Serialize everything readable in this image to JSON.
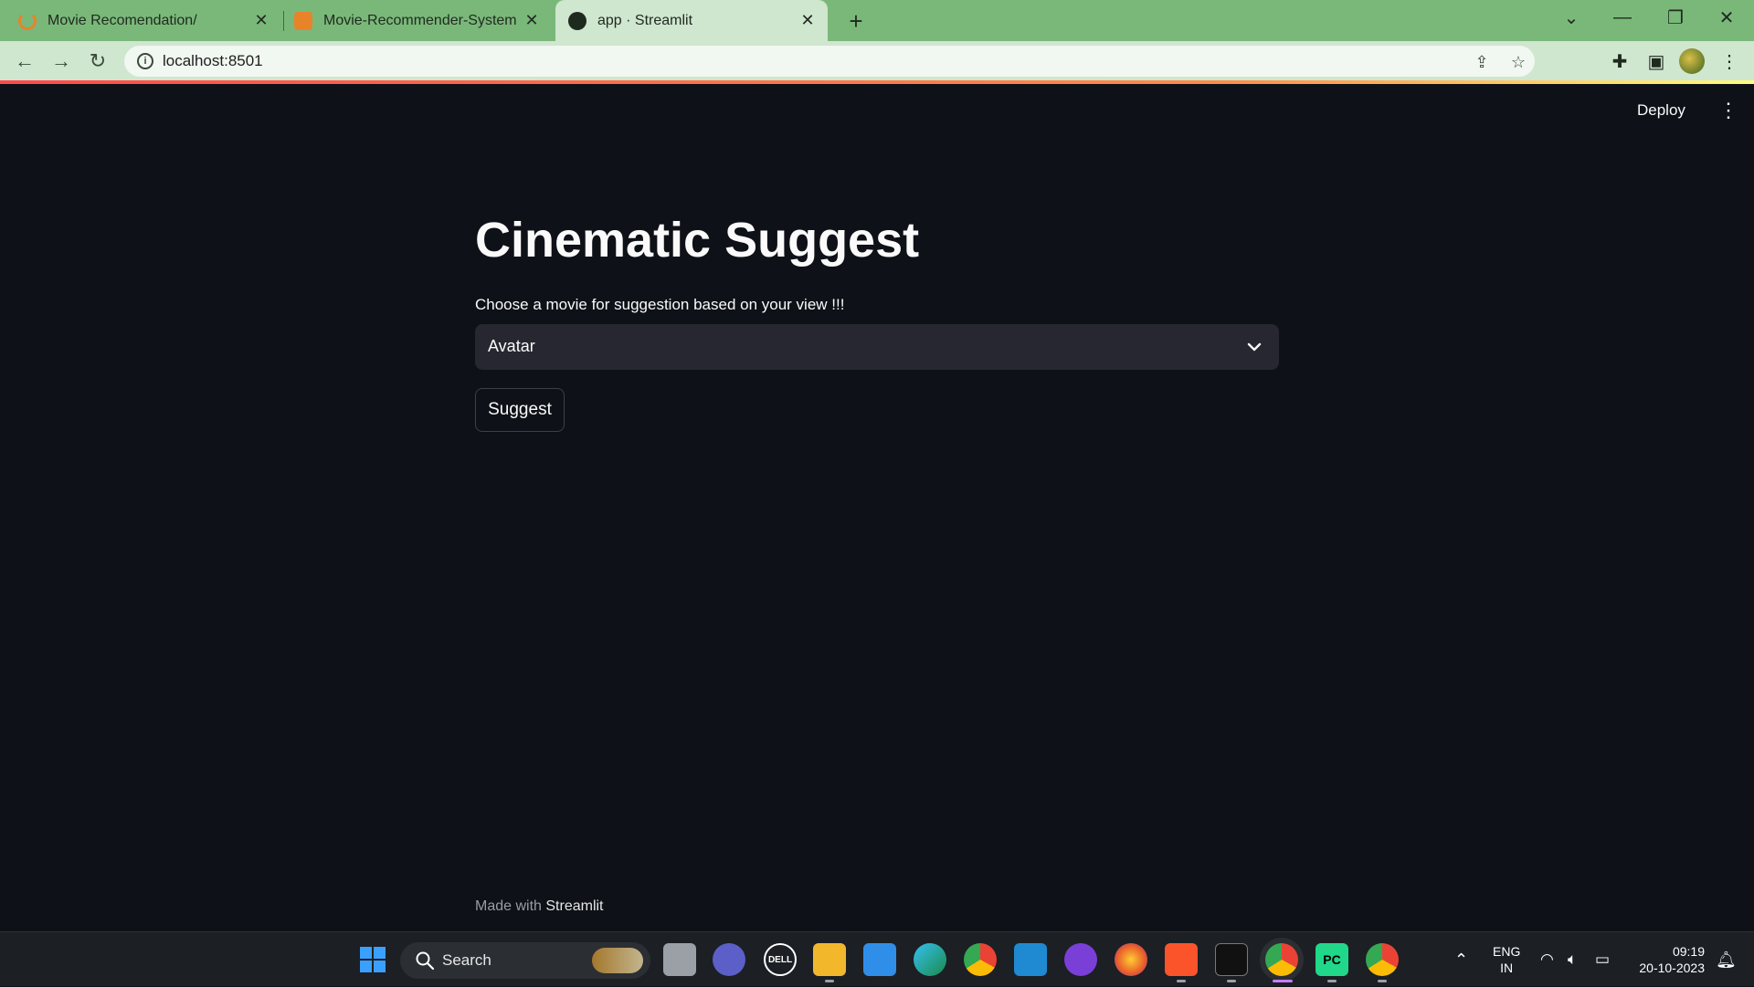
{
  "browser": {
    "tabs": [
      {
        "title": "Movie Recomendation/",
        "favicon": "loading-spinner-icon",
        "color": "#e8832a"
      },
      {
        "title": "Movie-Recommender-System - J",
        "favicon": "jupyter-icon",
        "color": "#e8832a"
      },
      {
        "title": "app · Streamlit",
        "favicon": "streamlit-icon",
        "color": "#ff4b4b"
      }
    ],
    "url": "localhost:8501"
  },
  "app": {
    "deploy_label": "Deploy",
    "title": "Cinematic Suggest",
    "select_label": "Choose a movie for suggestion based on your view !!!",
    "select_value": "Avatar",
    "button_label": "Suggest",
    "footer_prefix": "Made with",
    "footer_brand": "Streamlit"
  },
  "taskbar": {
    "search_label": "Search",
    "dell_label": "DELL",
    "pycharm_label": "PC",
    "language": "ENG",
    "region": "IN",
    "time": "09:19",
    "date": "20-10-2023"
  },
  "colors": {
    "accent": "#ff4b4b",
    "background": "#0e1117",
    "widget": "#262730"
  }
}
